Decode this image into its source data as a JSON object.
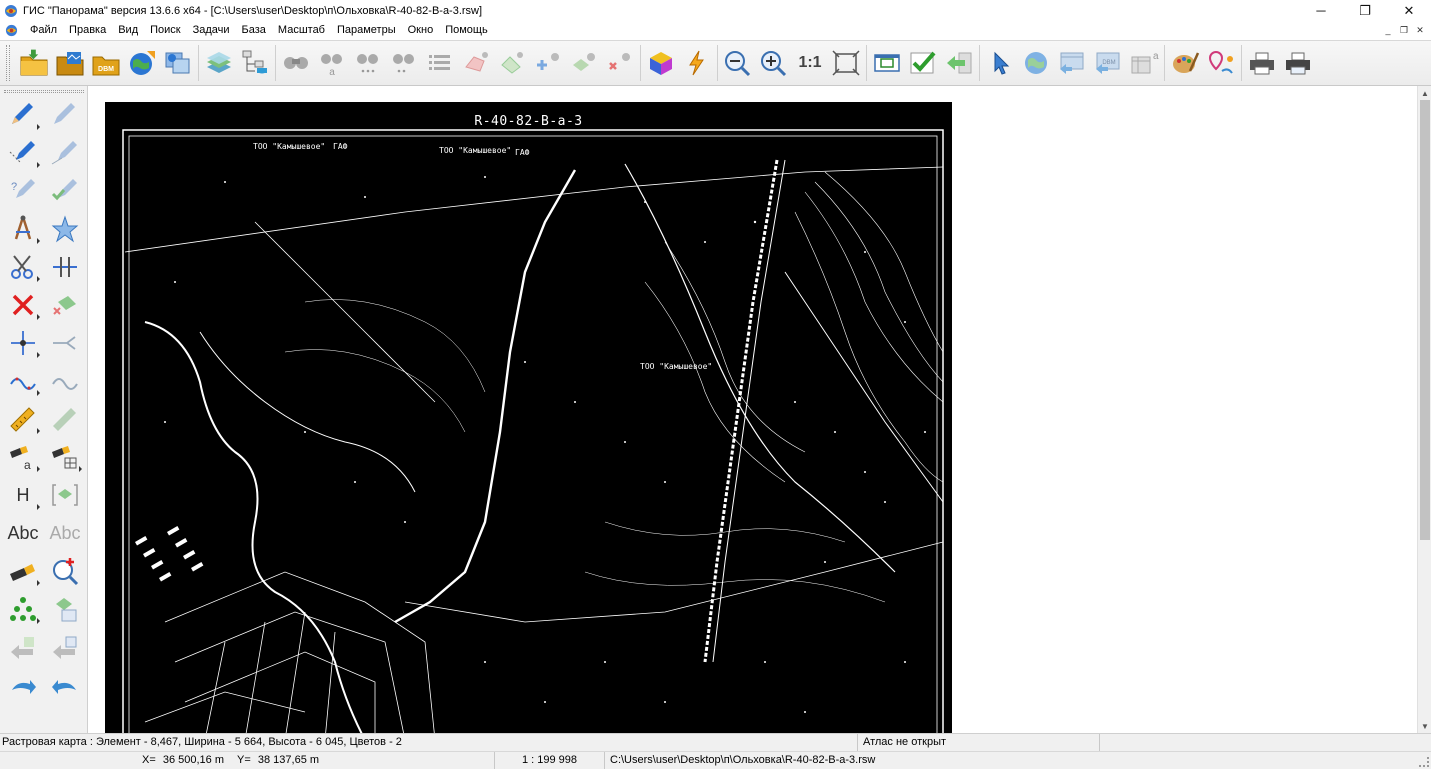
{
  "window": {
    "title": "ГИС \"Панорама\" версия 13.6.6 x64 - [C:\\Users\\user\\Desktop\\п\\Ольховка\\R-40-82-В-а-3.rsw]",
    "minimize": "─",
    "restore": "❐",
    "close": "✕"
  },
  "menu": {
    "items": [
      "Файл",
      "Правка",
      "Вид",
      "Поиск",
      "Задачи",
      "База",
      "Масштаб",
      "Параметры",
      "Окно",
      "Помощь"
    ],
    "mdi_minimize": "_",
    "mdi_restore": "❐",
    "mdi_close": "✕"
  },
  "toolbar": {
    "scale_one_to_one": "1:1",
    "buttons": [
      "open-folder",
      "open-map",
      "open-dbm",
      "internet-map",
      "map-list",
      "layers",
      "data-tree",
      "search-object",
      "search-name",
      "search-attrib",
      "search-more",
      "object-list",
      "select-object",
      "select-by-area",
      "add-object",
      "select-filter",
      "deselect",
      "cube3d",
      "lightning",
      "zoom-out",
      "zoom-in",
      "scale-1-1",
      "full-extent",
      "map-frame",
      "check",
      "back",
      "cursor",
      "globe",
      "catalog",
      "dbm-catalog",
      "properties",
      "palette",
      "pin-route",
      "print",
      "print-preview"
    ]
  },
  "leftpanel": {
    "text_tool_active": "Abc",
    "text_tool_inactive": "Abc",
    "heading_tool": "H"
  },
  "map": {
    "sheet_title": "R-40-82-В-а-3",
    "labels": [
      "ТОО \"Камышевое\"",
      "ГАФ",
      "ТОО \"Камышевое\"",
      "ГАФ",
      "ТОО \"Камышевое\""
    ]
  },
  "status": {
    "layer_info": "Растровая карта : Элемент - 8,467, Ширина - 5 664, Высота - 6 045, Цветов - 2",
    "atlas": "Атлас не открыт",
    "x_label": "X=",
    "x_value": "36 500,16 m",
    "y_label": "Y=",
    "y_value": "38 137,65 m",
    "scale": "1 : 199 998",
    "path": "C:\\Users\\user\\Desktop\\п\\Ольховка\\R-40-82-В-а-3.rsw"
  }
}
